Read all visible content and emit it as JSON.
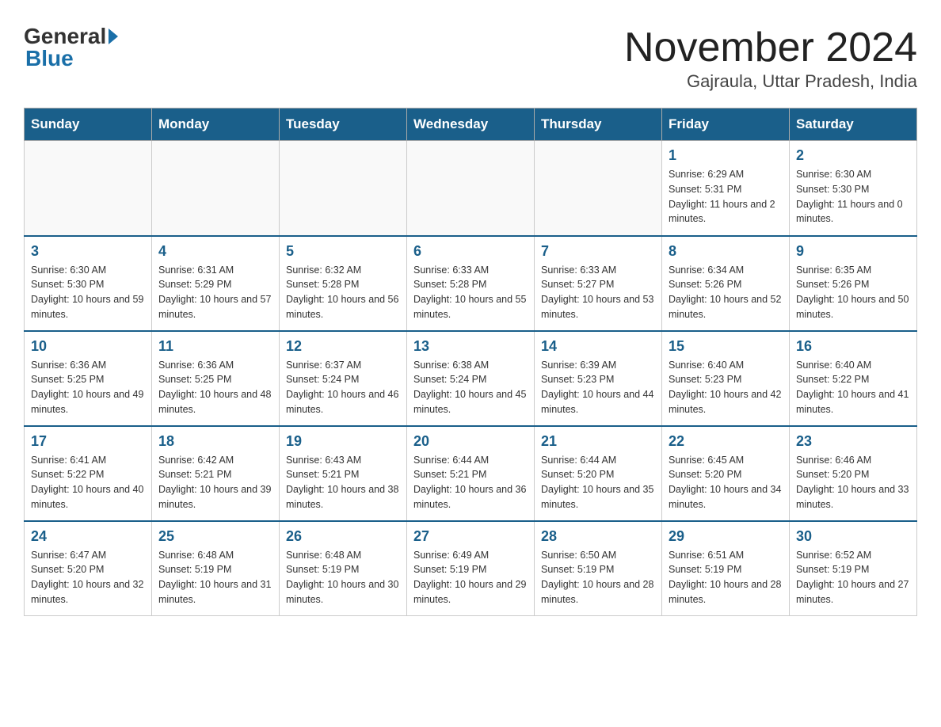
{
  "logo": {
    "general": "General",
    "blue": "Blue"
  },
  "header": {
    "month_title": "November 2024",
    "location": "Gajraula, Uttar Pradesh, India"
  },
  "weekdays": [
    "Sunday",
    "Monday",
    "Tuesday",
    "Wednesday",
    "Thursday",
    "Friday",
    "Saturday"
  ],
  "weeks": [
    [
      {
        "day": "",
        "info": ""
      },
      {
        "day": "",
        "info": ""
      },
      {
        "day": "",
        "info": ""
      },
      {
        "day": "",
        "info": ""
      },
      {
        "day": "",
        "info": ""
      },
      {
        "day": "1",
        "info": "Sunrise: 6:29 AM\nSunset: 5:31 PM\nDaylight: 11 hours and 2 minutes."
      },
      {
        "day": "2",
        "info": "Sunrise: 6:30 AM\nSunset: 5:30 PM\nDaylight: 11 hours and 0 minutes."
      }
    ],
    [
      {
        "day": "3",
        "info": "Sunrise: 6:30 AM\nSunset: 5:30 PM\nDaylight: 10 hours and 59 minutes."
      },
      {
        "day": "4",
        "info": "Sunrise: 6:31 AM\nSunset: 5:29 PM\nDaylight: 10 hours and 57 minutes."
      },
      {
        "day": "5",
        "info": "Sunrise: 6:32 AM\nSunset: 5:28 PM\nDaylight: 10 hours and 56 minutes."
      },
      {
        "day": "6",
        "info": "Sunrise: 6:33 AM\nSunset: 5:28 PM\nDaylight: 10 hours and 55 minutes."
      },
      {
        "day": "7",
        "info": "Sunrise: 6:33 AM\nSunset: 5:27 PM\nDaylight: 10 hours and 53 minutes."
      },
      {
        "day": "8",
        "info": "Sunrise: 6:34 AM\nSunset: 5:26 PM\nDaylight: 10 hours and 52 minutes."
      },
      {
        "day": "9",
        "info": "Sunrise: 6:35 AM\nSunset: 5:26 PM\nDaylight: 10 hours and 50 minutes."
      }
    ],
    [
      {
        "day": "10",
        "info": "Sunrise: 6:36 AM\nSunset: 5:25 PM\nDaylight: 10 hours and 49 minutes."
      },
      {
        "day": "11",
        "info": "Sunrise: 6:36 AM\nSunset: 5:25 PM\nDaylight: 10 hours and 48 minutes."
      },
      {
        "day": "12",
        "info": "Sunrise: 6:37 AM\nSunset: 5:24 PM\nDaylight: 10 hours and 46 minutes."
      },
      {
        "day": "13",
        "info": "Sunrise: 6:38 AM\nSunset: 5:24 PM\nDaylight: 10 hours and 45 minutes."
      },
      {
        "day": "14",
        "info": "Sunrise: 6:39 AM\nSunset: 5:23 PM\nDaylight: 10 hours and 44 minutes."
      },
      {
        "day": "15",
        "info": "Sunrise: 6:40 AM\nSunset: 5:23 PM\nDaylight: 10 hours and 42 minutes."
      },
      {
        "day": "16",
        "info": "Sunrise: 6:40 AM\nSunset: 5:22 PM\nDaylight: 10 hours and 41 minutes."
      }
    ],
    [
      {
        "day": "17",
        "info": "Sunrise: 6:41 AM\nSunset: 5:22 PM\nDaylight: 10 hours and 40 minutes."
      },
      {
        "day": "18",
        "info": "Sunrise: 6:42 AM\nSunset: 5:21 PM\nDaylight: 10 hours and 39 minutes."
      },
      {
        "day": "19",
        "info": "Sunrise: 6:43 AM\nSunset: 5:21 PM\nDaylight: 10 hours and 38 minutes."
      },
      {
        "day": "20",
        "info": "Sunrise: 6:44 AM\nSunset: 5:21 PM\nDaylight: 10 hours and 36 minutes."
      },
      {
        "day": "21",
        "info": "Sunrise: 6:44 AM\nSunset: 5:20 PM\nDaylight: 10 hours and 35 minutes."
      },
      {
        "day": "22",
        "info": "Sunrise: 6:45 AM\nSunset: 5:20 PM\nDaylight: 10 hours and 34 minutes."
      },
      {
        "day": "23",
        "info": "Sunrise: 6:46 AM\nSunset: 5:20 PM\nDaylight: 10 hours and 33 minutes."
      }
    ],
    [
      {
        "day": "24",
        "info": "Sunrise: 6:47 AM\nSunset: 5:20 PM\nDaylight: 10 hours and 32 minutes."
      },
      {
        "day": "25",
        "info": "Sunrise: 6:48 AM\nSunset: 5:19 PM\nDaylight: 10 hours and 31 minutes."
      },
      {
        "day": "26",
        "info": "Sunrise: 6:48 AM\nSunset: 5:19 PM\nDaylight: 10 hours and 30 minutes."
      },
      {
        "day": "27",
        "info": "Sunrise: 6:49 AM\nSunset: 5:19 PM\nDaylight: 10 hours and 29 minutes."
      },
      {
        "day": "28",
        "info": "Sunrise: 6:50 AM\nSunset: 5:19 PM\nDaylight: 10 hours and 28 minutes."
      },
      {
        "day": "29",
        "info": "Sunrise: 6:51 AM\nSunset: 5:19 PM\nDaylight: 10 hours and 28 minutes."
      },
      {
        "day": "30",
        "info": "Sunrise: 6:52 AM\nSunset: 5:19 PM\nDaylight: 10 hours and 27 minutes."
      }
    ]
  ]
}
